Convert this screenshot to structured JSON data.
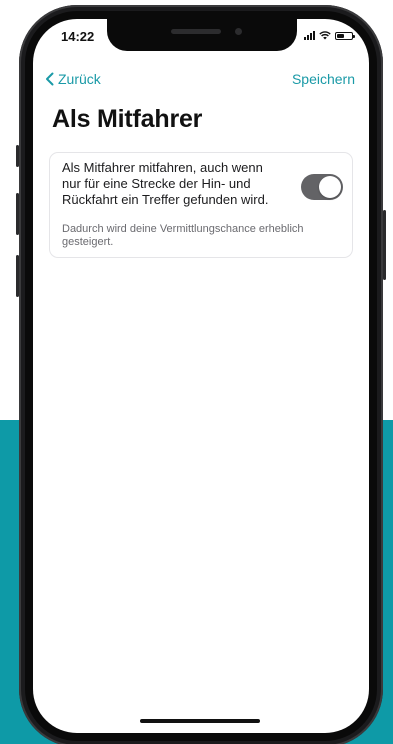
{
  "status_bar": {
    "time": "14:22",
    "icons": [
      "signal-icon",
      "wifi-icon",
      "battery-icon"
    ]
  },
  "nav": {
    "back_label": "Zurück",
    "save_label": "Speichern"
  },
  "page": {
    "title": "Als Mitfahrer"
  },
  "setting": {
    "description": "Als Mitfahrer mitfahren, auch wenn nur für eine Strecke der Hin- und Rückfahrt ein Treffer gefunden wird.",
    "hint": "Dadurch wird deine Vermittlungschance erheblich gesteigert.",
    "enabled": true
  },
  "colors": {
    "accent": "#1a9aa7",
    "background_teal": "#0e9aa7",
    "toggle_on": "#636366"
  }
}
